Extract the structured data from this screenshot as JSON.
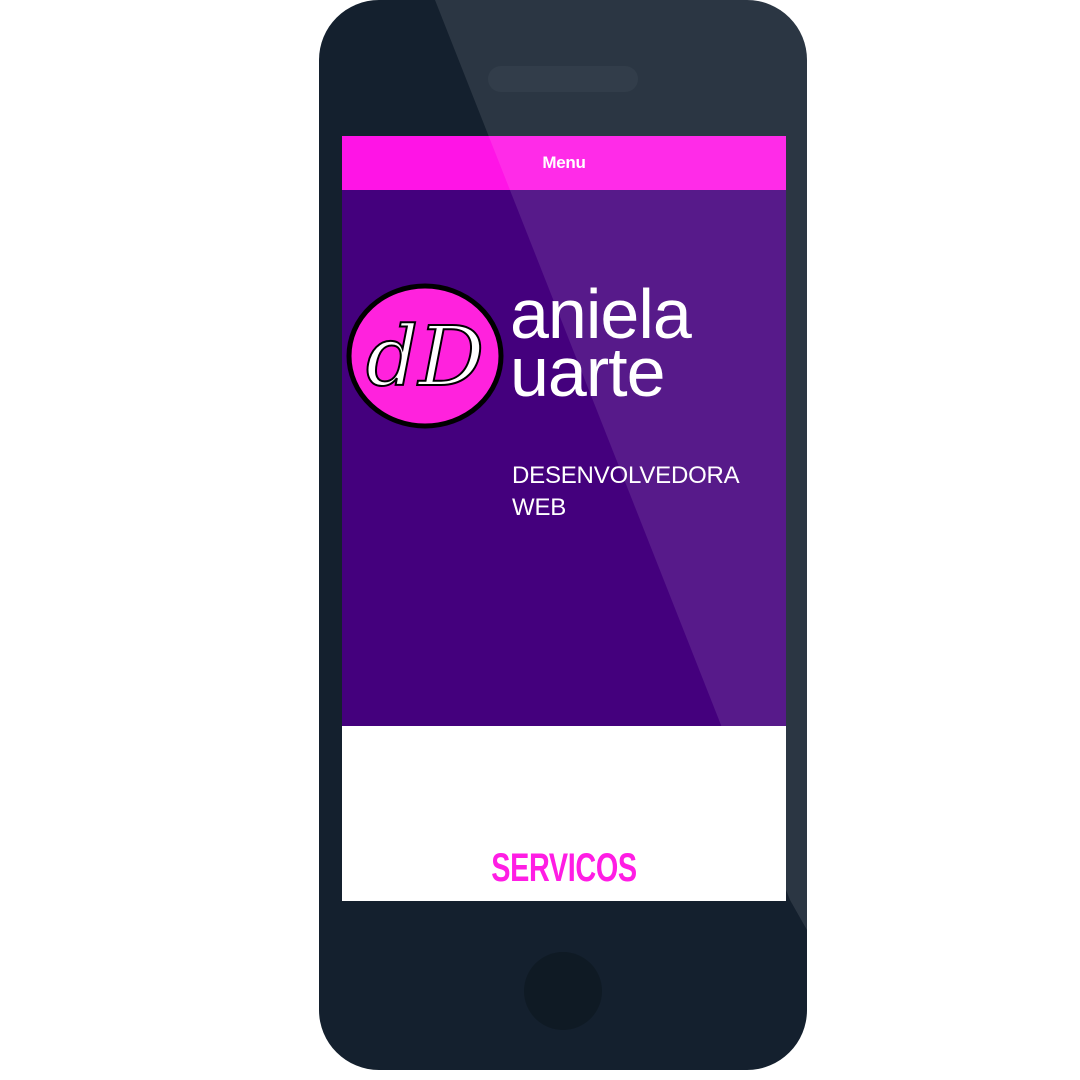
{
  "device": {
    "body_color": "#14202e",
    "screen_background": "#ffffff"
  },
  "site": {
    "menu_label": "Menu",
    "menu_color": "#ff14e6",
    "hero_color": "#44007d",
    "logo": {
      "monogram": "dD",
      "badge_color": "#ff22dd",
      "name_line_1": "aniela",
      "name_line_2": "uarte"
    },
    "tagline_line_1": "DESENVOLVEDORA",
    "tagline_line_2": "WEB",
    "section_title": "SERVICOS",
    "section_title_color": "#ff1de4"
  }
}
